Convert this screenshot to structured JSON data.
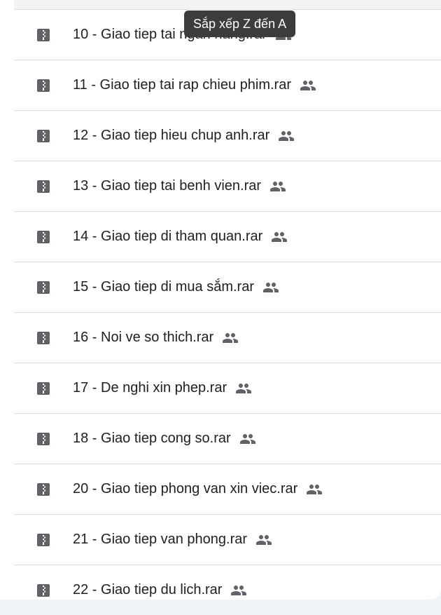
{
  "tooltip": {
    "text": "Sắp xếp Z đến A"
  },
  "files": [
    {
      "name": "10 - Giao tiep tai ngan hang.rar",
      "icon": "archive-icon",
      "shared": true
    },
    {
      "name": "11 - Giao tiep tai rap chieu phim.rar",
      "icon": "archive-icon",
      "shared": true
    },
    {
      "name": "12 - Giao tiep hieu chup anh.rar",
      "icon": "archive-icon",
      "shared": true
    },
    {
      "name": "13 - Giao tiep tai benh vien.rar",
      "icon": "archive-icon",
      "shared": true
    },
    {
      "name": "14 - Giao tiep di tham quan.rar",
      "icon": "archive-icon",
      "shared": true
    },
    {
      "name": "15 - Giao tiep di mua sắm.rar",
      "icon": "archive-icon",
      "shared": true
    },
    {
      "name": "16 - Noi ve so thich.rar",
      "icon": "archive-icon",
      "shared": true
    },
    {
      "name": "17 - De nghi xin phep.rar",
      "icon": "archive-icon",
      "shared": true
    },
    {
      "name": "18 - Giao tiep cong so.rar",
      "icon": "archive-icon",
      "shared": true
    },
    {
      "name": "20 - Giao tiep phong van xin viec.rar",
      "icon": "archive-icon",
      "shared": true
    },
    {
      "name": "21 - Giao tiep van phong.rar",
      "icon": "archive-icon",
      "shared": true
    },
    {
      "name": "22 - Giao tiep du lich.rar",
      "icon": "archive-icon",
      "shared": true
    }
  ],
  "colors": {
    "text": "#1f1f1f",
    "icon": "#5f6368",
    "divider": "#dadce0",
    "tooltip_bg": "#3c3c3c",
    "background": "#f0f4f9"
  }
}
